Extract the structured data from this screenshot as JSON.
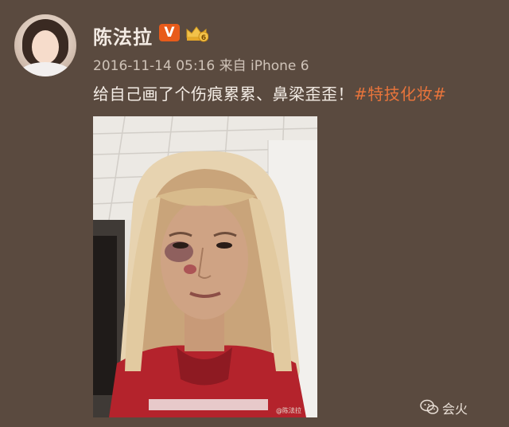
{
  "post": {
    "username": "陈法拉",
    "verified_badge": "V",
    "level_badge": "6",
    "timestamp": "2016-11-14 05:16 来自 iPhone 6",
    "text": "给自己画了个伤痕累累、鼻梁歪歪！",
    "hashtag": "#特技化妆#",
    "photo_caption": "@陈法拉"
  },
  "watermark": {
    "brand": "会火",
    "icon": "wechat-icon"
  },
  "colors": {
    "background": "#5a4a3f",
    "username": "#f3ebe4",
    "meta": "#cfc3b8",
    "hashtag": "#e8743b",
    "verified": "#e85b1a",
    "crown": "#f2c24a"
  }
}
